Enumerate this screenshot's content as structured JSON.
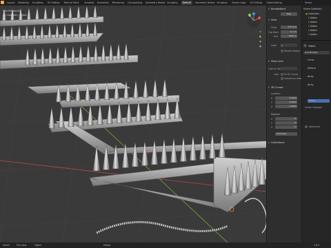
{
  "topbar": {
    "tabs": [
      "Layout",
      "Modeling",
      "Sculpting",
      "UV Editing",
      "Texture Paint",
      "Shading",
      "Animation",
      "Rendering",
      "Compositing",
      "Geometry Nodes",
      "Scripting",
      "Default",
      "Geometry Nodes",
      "Scripting",
      "Scene Logic",
      "UV Editing",
      "Video Editing"
    ],
    "active_index": 11,
    "scene_label": "Scene"
  },
  "viewport": {
    "view_label": "User Perspective",
    "collection_label": "(1) Collection | Object",
    "axis_x": "X",
    "axis_y": "Y",
    "axis_z": "Z"
  },
  "npanel": {
    "annotations_header": "Annotations",
    "new_label": "New",
    "view_header": "View",
    "focal_label": "Focal",
    "focal_value": "170 mm",
    "clip_start_label": "Clip Start",
    "clip_start_value": "0.1 m",
    "clip_end_label": "End",
    "clip_end_value": "1000 m",
    "local_label": "Local",
    "render_region_label": "Render Region",
    "view_lock_header": "View Lock",
    "lock_to_object_label": "Lock to Object",
    "lock_label": "Lock",
    "to_3d_cursor_label": "To 3D Cursor",
    "camera_to_view_label": "Camera to View",
    "cursor_header": "3D Cursor",
    "location_label": "Location",
    "loc_x": "0.0000",
    "loc_y": "0.0000",
    "loc_z": "0.0000",
    "rotation_label": "Rotation",
    "rot_x": "0°",
    "rot_y": "0°",
    "rot_z": "0°",
    "rotation_mode": "XYZ Euler",
    "collections_header": "Collections",
    "side_tabs": [
      "Item",
      "Tool",
      "View"
    ]
  },
  "rpanel": {
    "scene_collection_label": "Scene Collection",
    "collection_label": "Collection",
    "outliner_items": [
      "Collection",
      "Spikes",
      "Spikes",
      "Spikes",
      "Spikes",
      "Spikes"
    ],
    "props_object_label": "Object",
    "add_modifier_label": "Add Modifier",
    "modifier_items": [
      "Curve",
      "Deform",
      "Array",
      "Array"
    ],
    "curve_label": "Curve",
    "levels_viewport_label": "Levels Viewport",
    "advanced_label": "Advanced"
  },
  "bottombar": {
    "select_label": "Select",
    "pan_label": "Pan View",
    "context_label": "Object",
    "global_label": "Global",
    "version_label": "3.6.0"
  },
  "colors": {
    "selection_orange": "#e69a3a",
    "accent_blue": "#4772b3",
    "x_axis": "#e04a5a",
    "y_axis": "#8bc34a",
    "z_axis": "#4a8fe0"
  }
}
